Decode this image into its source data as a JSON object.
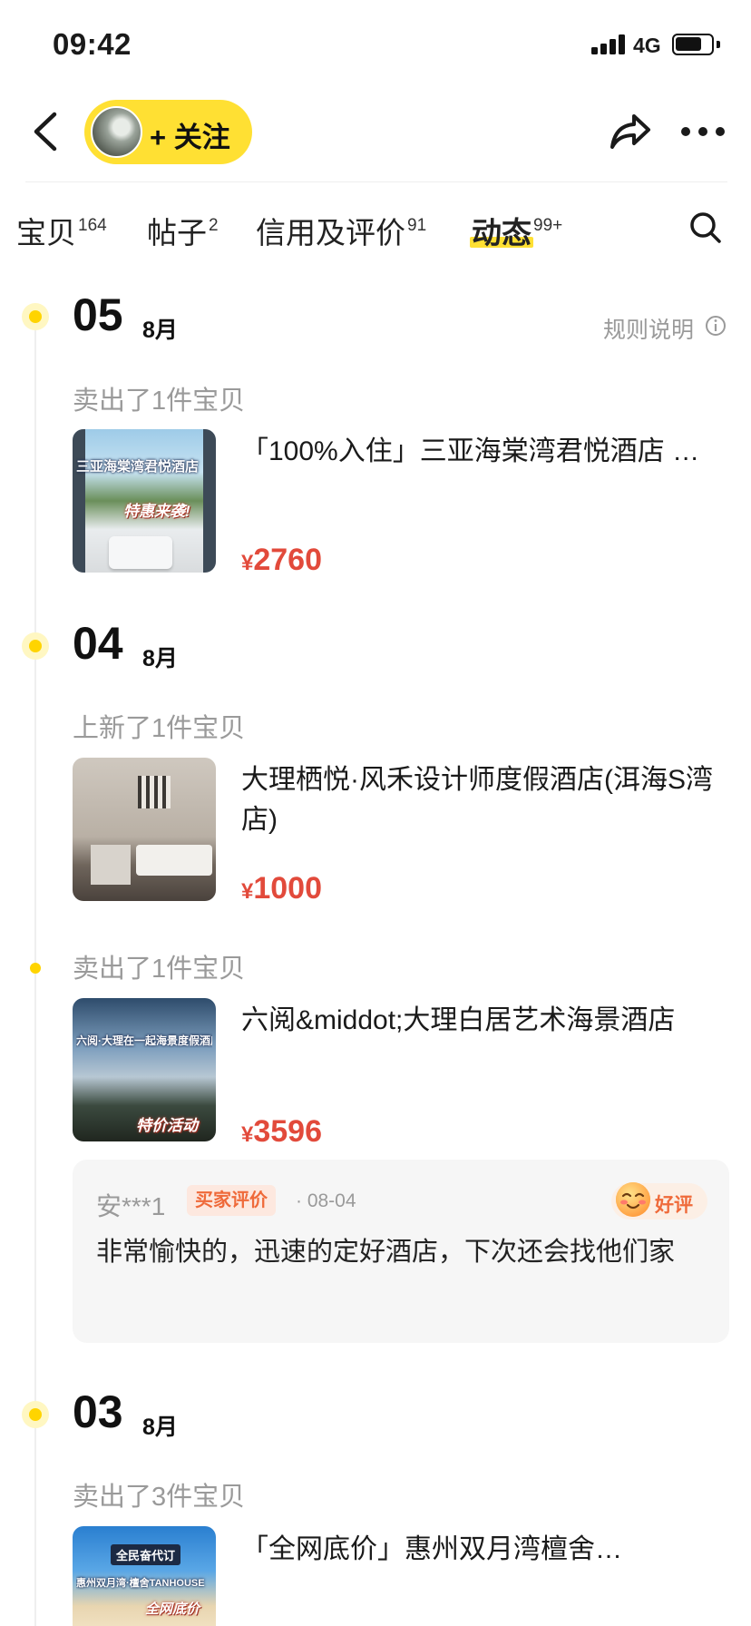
{
  "status_bar": {
    "time": "09:42",
    "network": "4G"
  },
  "header": {
    "follow_label": "+ 关注"
  },
  "tabs": [
    {
      "label": "宝贝",
      "count": "164"
    },
    {
      "label": "帖子",
      "count": "2"
    },
    {
      "label": "信用及评价",
      "count": "91"
    },
    {
      "label": "动态",
      "count": "99+"
    }
  ],
  "rules_label": "规则说明",
  "groups": [
    {
      "day": "05",
      "month": "8月",
      "events": [
        {
          "label": "卖出了1件宝贝",
          "thumb_caption": "三亚海棠湾君悦酒店",
          "thumb_badge": "特惠来袭!",
          "title": "「100%入住」三亚海棠湾君悦酒店 …",
          "currency": "¥",
          "price": "2760"
        }
      ]
    },
    {
      "day": "04",
      "month": "8月",
      "events": [
        {
          "label": "上新了1件宝贝",
          "title": "大理栖悦·风禾设计师度假酒店(洱海S湾店)",
          "currency": "¥",
          "price": "1000"
        },
        {
          "label": "卖出了1件宝贝",
          "thumb_caption": "六阅·大理在一起海景度假酒店",
          "thumb_badge": "特价活动",
          "title": "六阅&middot;大理白居艺术海景酒店",
          "currency": "¥",
          "price": "3596"
        }
      ]
    },
    {
      "day": "03",
      "month": "8月",
      "events": [
        {
          "label": "卖出了3件宝贝",
          "thumb_caption": "全民奋代订",
          "thumb_caption2": "惠州双月湾·檀舍TANHOUSE",
          "thumb_badge": "全网底价",
          "title": "「全网底价」惠州双月湾檀舍…"
        }
      ]
    }
  ],
  "review": {
    "user": "安***1",
    "tag": "买家评价",
    "date": "· 08-04",
    "rating": "好评",
    "text": "非常愉快的，迅速的定好酒店，下次还会找他们家"
  },
  "colors": {
    "accent_yellow": "#ffe033",
    "price_red": "#e24a3b",
    "muted_gray": "#9a9a9a"
  }
}
